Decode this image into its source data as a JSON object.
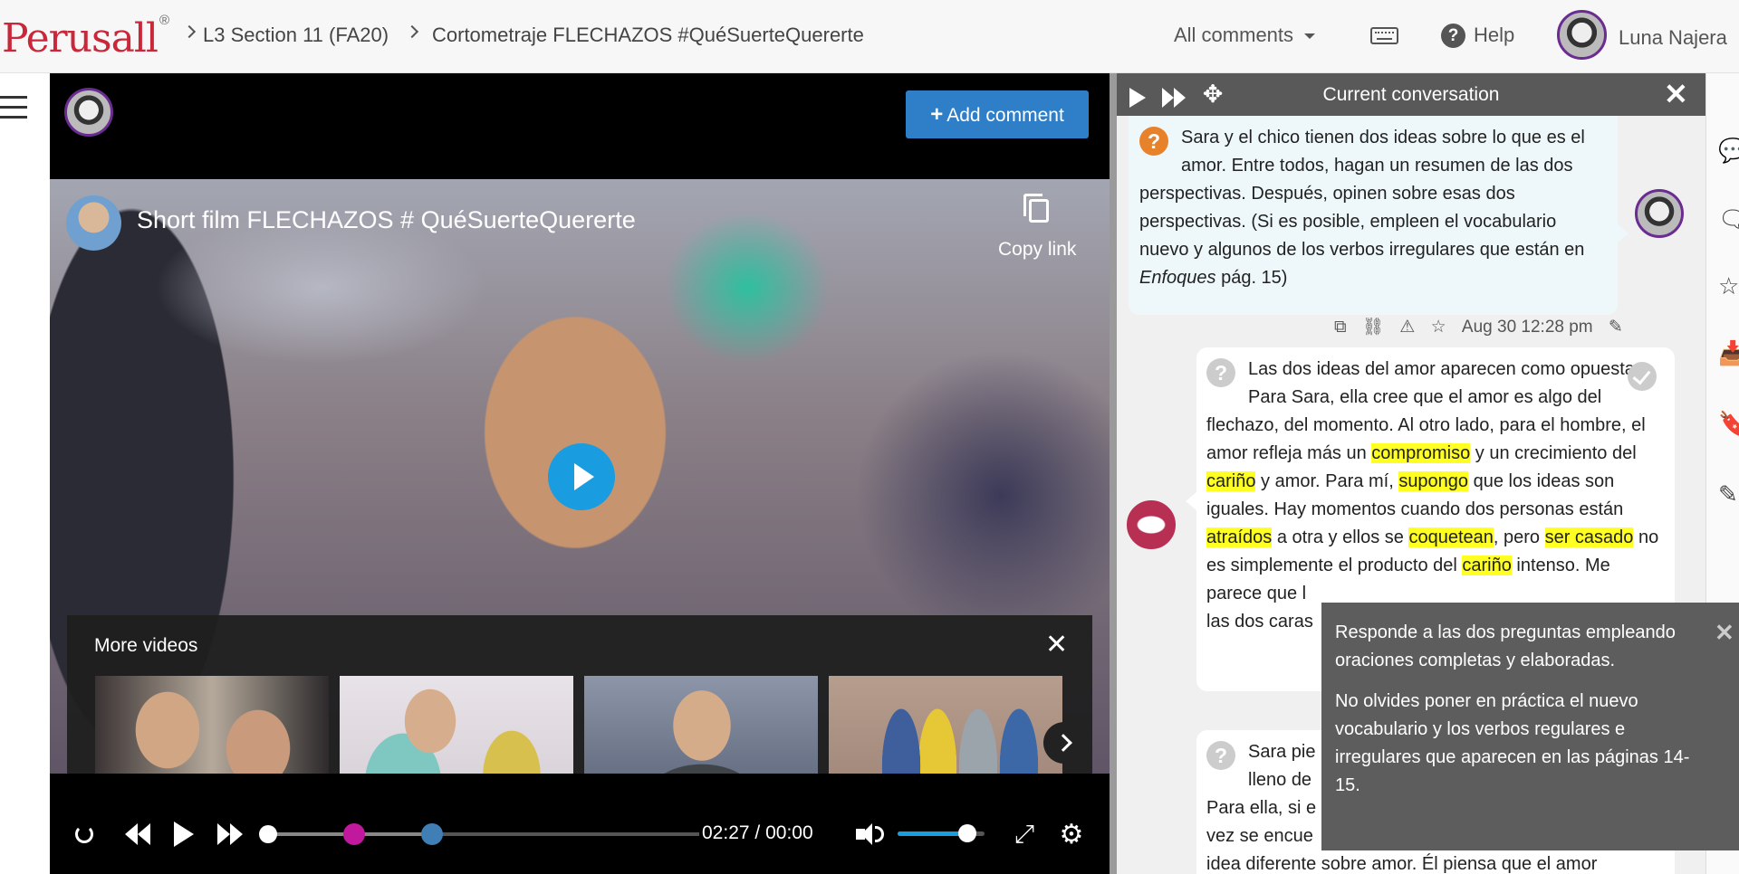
{
  "header": {
    "logo": "Perusall",
    "logo_mark": "®",
    "breadcrumb": [
      "L3 Section 11 (FA20)",
      "Cortometraje FLECHAZOS #QuéSuerteQuererte"
    ],
    "filter_label": "All comments",
    "help_label": "Help",
    "user_name": "Luna Najera"
  },
  "toolbar": {
    "add_comment_label": "Add comment"
  },
  "video": {
    "title": "Short film FLECHAZOS # QuéSuerteQuererte",
    "copy_link_label": "Copy link",
    "more_videos_title": "More videos",
    "current_time": "02:27",
    "time_separator": "/",
    "duration": "00:00",
    "played_fraction": 0.4,
    "playhead_fraction": 0.0,
    "markers": [
      {
        "color": "#c2189e",
        "fraction": 0.2
      },
      {
        "color": "#3f7fb5",
        "fraction": 0.38
      }
    ],
    "volume_fraction": 0.8
  },
  "conversation": {
    "title": "Current conversation",
    "question": {
      "icon": "question-orange-icon",
      "text_before": "Sara y el chico tienen dos ideas sobre lo que es el amor. Entre todos, hagan un resumen de las dos perspectivas. Después, opinen sobre esas dos perspectivas. (Si es posible, empleen el vocabulario nuevo y algunos de los verbos irregulares que están en ",
      "text_italic": "Enfoques",
      "text_after": " pág. 15)",
      "timestamp": "Aug 30 12:28 pm"
    },
    "reply": {
      "segments": [
        {
          "t": "Las dos ideas del amor aparecen como opuestas. Para Sara, ella cree que el amor es algo del flechazo, del momento. Al otro lado, para el hombre, el amor refleja más un ",
          "h": false
        },
        {
          "t": "compromiso",
          "h": true
        },
        {
          "t": " y un crecimiento del ",
          "h": false
        },
        {
          "t": "cariño",
          "h": true
        },
        {
          "t": " y amor. Para mí, ",
          "h": false
        },
        {
          "t": "supongo",
          "h": true
        },
        {
          "t": " que los ideas son iguales. Hay momentos cuando dos personas están ",
          "h": false
        },
        {
          "t": "atraídos",
          "h": true
        },
        {
          "t": " a otra y ellos se ",
          "h": false
        },
        {
          "t": "coquetean",
          "h": true
        },
        {
          "t": ", pero ",
          "h": false
        },
        {
          "t": "ser casado",
          "h": true
        },
        {
          "t": " no es simplemente el producto del ",
          "h": false
        },
        {
          "t": "cariño",
          "h": true
        },
        {
          "t": " intenso. Me parece que l",
          "h": false
        },
        {
          "t": "\nlas dos caras",
          "h": false
        }
      ]
    },
    "reply2": {
      "lines": [
        "Sara pie",
        "lleno de",
        "Para ella, si e",
        "vez se encue",
        "idea diferente sobre amor. Él piensa que el amor"
      ]
    }
  },
  "tooltip": {
    "paragraph1": "Responde a las dos preguntas empleando oraciones completas y elaboradas.",
    "paragraph2": "No olvides poner en práctica el nuevo vocabulario y los verbos regulares e irregulares que aparecen en las páginas 14-15."
  },
  "rail_icons": [
    "comment-icon",
    "comments-icon",
    "star-icon",
    "inbox-icon",
    "bookmark-icon",
    "pencil-icon"
  ]
}
